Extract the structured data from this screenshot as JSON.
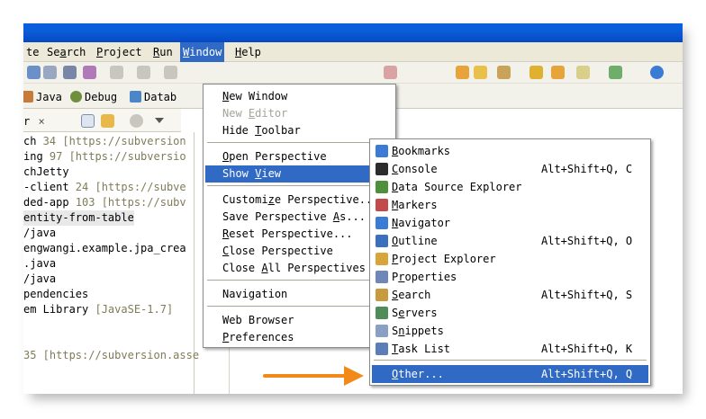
{
  "colors": {
    "menu_highlight": "#316ac5",
    "arrow": "#f28a1a",
    "titlebar": "#0a5fe0",
    "decoration": "#7f7c57"
  },
  "menubar": {
    "items": [
      {
        "label": "te",
        "mnemonic": ""
      },
      {
        "label": "Search",
        "pre": "Se",
        "key": "a",
        "post": "rch"
      },
      {
        "label": "Project",
        "pre": "",
        "key": "P",
        "post": "roject"
      },
      {
        "label": "Run",
        "pre": "",
        "key": "R",
        "post": "un"
      },
      {
        "label": "Window",
        "pre": "",
        "key": "W",
        "post": "indow"
      },
      {
        "label": "Help",
        "pre": "",
        "key": "H",
        "post": "elp"
      }
    ]
  },
  "perspectives": [
    {
      "label": "Java",
      "icon": "java-perspective-icon"
    },
    {
      "label": "Debug",
      "icon": "debug-bug-icon"
    },
    {
      "label": "Datab",
      "icon": "database-icon"
    }
  ],
  "view_tab": {
    "label": "r",
    "close": "×"
  },
  "tree": [
    {
      "text": "ch",
      "dec": " 34 [https://subversion"
    },
    {
      "text": "ing",
      "dec": " 97 [https://subversio"
    },
    {
      "text": "chJetty",
      "dec": ""
    },
    {
      "text": "-client",
      "dec": " 24 [https://subve"
    },
    {
      "text": "ded-app",
      "dec": " 103 [https://subv"
    },
    {
      "text": "entity-from-table",
      "dec": ""
    },
    {
      "text": "/java",
      "dec": ""
    },
    {
      "text": "engwangi.example.jpa_crea",
      "dec": ""
    },
    {
      "text": ".java",
      "dec": ""
    },
    {
      "text": "/java",
      "dec": ""
    },
    {
      "text": "pendencies",
      "dec": ""
    },
    {
      "text": "em Library",
      "dec": " [JavaSE-1.7]"
    },
    {
      "text": "",
      "dec": ""
    },
    {
      "text": "",
      "dec": ""
    },
    {
      "text": "",
      "dec": " 35 [https://subversion.asse"
    }
  ],
  "window_menu": {
    "items": [
      {
        "pre": "",
        "key": "N",
        "post": "ew Window",
        "disabled": false
      },
      {
        "pre": "New ",
        "key": "E",
        "post": "ditor",
        "disabled": true
      },
      {
        "pre": "Hide ",
        "key": "T",
        "post": "oolbar",
        "disabled": false
      },
      {
        "pre": "",
        "key": "O",
        "post": "pen Perspective",
        "disabled": false
      },
      {
        "pre": "Show ",
        "key": "V",
        "post": "iew",
        "disabled": false
      },
      {
        "pre": "Customi",
        "key": "z",
        "post": "e Perspective...",
        "disabled": false
      },
      {
        "pre": "Save Perspective ",
        "key": "A",
        "post": "s...",
        "disabled": false
      },
      {
        "pre": "",
        "key": "R",
        "post": "eset Perspective...",
        "disabled": false
      },
      {
        "pre": "",
        "key": "C",
        "post": "lose Perspective",
        "disabled": false
      },
      {
        "pre": "Close ",
        "key": "A",
        "post": "ll Perspectives",
        "disabled": false
      },
      {
        "pre": "Navi",
        "key": "g",
        "post": "ation",
        "disabled": false
      },
      {
        "pre": "Web Browser",
        "key": "",
        "post": "",
        "disabled": false
      },
      {
        "pre": "",
        "key": "P",
        "post": "references",
        "disabled": false
      }
    ]
  },
  "view_menu": {
    "items": [
      {
        "pre": "",
        "key": "B",
        "post": "ookmarks",
        "shortcut": "",
        "icon": "bookmarks-icon"
      },
      {
        "pre": "",
        "key": "C",
        "post": "onsole",
        "shortcut": "Alt+Shift+Q, C",
        "icon": "console-icon"
      },
      {
        "pre": "",
        "key": "D",
        "post": "ata Source Explorer",
        "shortcut": "",
        "icon": "data-source-explorer-icon"
      },
      {
        "pre": "",
        "key": "M",
        "post": "arkers",
        "shortcut": "",
        "icon": "markers-icon"
      },
      {
        "pre": "",
        "key": "N",
        "post": "avigator",
        "shortcut": "",
        "icon": "navigator-icon"
      },
      {
        "pre": "",
        "key": "O",
        "post": "utline",
        "shortcut": "Alt+Shift+Q, O",
        "icon": "outline-icon"
      },
      {
        "pre": "",
        "key": "P",
        "post": "roject Explorer",
        "shortcut": "",
        "icon": "project-explorer-icon"
      },
      {
        "pre": "P",
        "key": "r",
        "post": "operties",
        "shortcut": "",
        "icon": "properties-icon"
      },
      {
        "pre": "",
        "key": "S",
        "post": "earch",
        "shortcut": "Alt+Shift+Q, S",
        "icon": "search-icon"
      },
      {
        "pre": "S",
        "key": "e",
        "post": "rvers",
        "shortcut": "",
        "icon": "servers-icon"
      },
      {
        "pre": "S",
        "key": "n",
        "post": "ippets",
        "shortcut": "",
        "icon": "snippets-icon"
      },
      {
        "pre": "",
        "key": "T",
        "post": "ask List",
        "shortcut": "Alt+Shift+Q, K",
        "icon": "task-list-icon"
      },
      {
        "pre": "",
        "key": "O",
        "post": "ther...",
        "shortcut": "Alt+Shift+Q, Q",
        "icon": ""
      }
    ]
  }
}
